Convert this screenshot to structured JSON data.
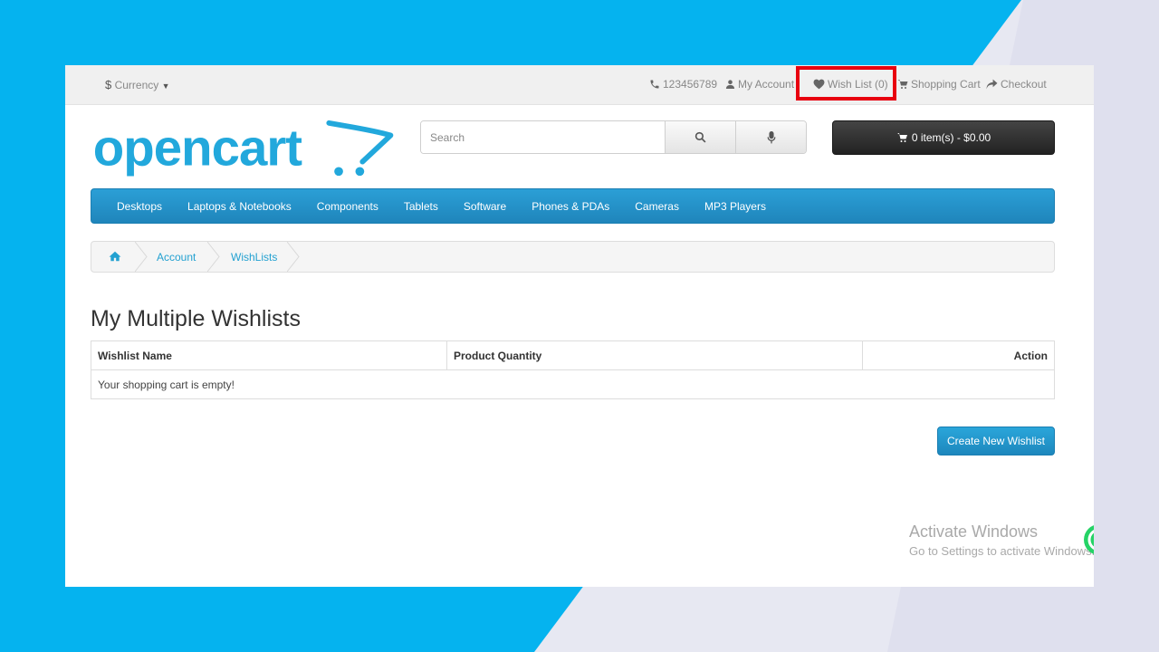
{
  "topbar": {
    "currency_symbol": "$",
    "currency_label": "Currency",
    "phone": "123456789",
    "my_account": "My Account",
    "wish_list": "Wish List (0)",
    "shopping_cart": "Shopping Cart",
    "checkout": "Checkout"
  },
  "header": {
    "logo_text": "opencart",
    "search_placeholder": "Search",
    "cart_summary": "0 item(s) - $0.00"
  },
  "menu": {
    "items": [
      "Desktops",
      "Laptops & Notebooks",
      "Components",
      "Tablets",
      "Software",
      "Phones & PDAs",
      "Cameras",
      "MP3 Players"
    ]
  },
  "breadcrumb": {
    "items": [
      "Account",
      "WishLists"
    ]
  },
  "page": {
    "title": "My Multiple Wishlists",
    "table": {
      "headers": [
        "Wishlist Name",
        "Product Quantity",
        "Action"
      ],
      "empty_message": "Your shopping cart is empty!"
    },
    "create_button": "Create New Wishlist"
  },
  "watermark": {
    "line1": "Activate Windows",
    "line2": "Go to Settings to activate Windows."
  },
  "colors": {
    "accent": "#23a1d1",
    "background_blue": "#05b3ef",
    "highlight_red": "#e8000f",
    "cart_dark": "#2e2e2e"
  }
}
